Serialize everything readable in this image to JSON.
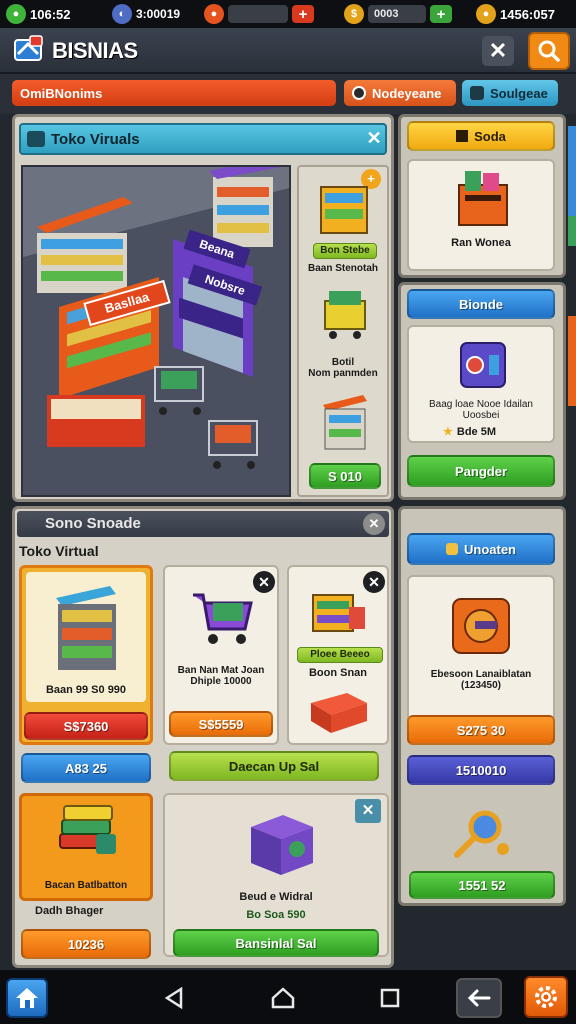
{
  "status": {
    "left_value": "106:52",
    "mid_value": "3:00019",
    "gold_value": "0003",
    "right_value": "1456:057"
  },
  "header": {
    "title": "BISNIAS"
  },
  "tabs": [
    {
      "label": "OmiBNonims"
    },
    {
      "label": "Nodeyeane"
    },
    {
      "label": "Soulgeae"
    }
  ],
  "store_panel": {
    "title": "Toko Viruals",
    "scene_signs": [
      "Basllaa",
      "Beana",
      "Nobsre"
    ],
    "items": [
      {
        "tag": "Bon Stebe",
        "name": "Baan Stenotah"
      },
      {
        "name": "Botil\nNom panmden"
      }
    ],
    "price_button": "S 010"
  },
  "right_top": {
    "header_button": "Soda",
    "card_label": "Ran Wonea"
  },
  "right_mid": {
    "header_button": "Bionde",
    "card_label": "Baag loae Nooe Idailan\nUoosbei",
    "card_price": "Bde 5M",
    "action_button": "Pangder"
  },
  "store2_panel": {
    "title": "Sono Snoade",
    "subtitle": "Toko Virtual",
    "card1": {
      "price_line": "Baan 99 S0 990",
      "button": "S$7360",
      "sub_button": "A83 25"
    },
    "card2": {
      "label": "Ban Nan Mat Joan\nDhiple 10000",
      "button": "S$5559"
    },
    "card3": {
      "tag": "Ploee Beeeo",
      "label": "Boon Snan"
    },
    "wide_button": "Daecan Up Sal",
    "card4": {
      "label": "Bacan Batlbatton",
      "sub_label": "Dadh Bhager",
      "button": "10236"
    },
    "card5": {
      "label": "Beud e Widral",
      "price": "Bo Soa 590",
      "button": "Bansinlal Sal"
    }
  },
  "right_bottom": {
    "header_button": "Unoaten",
    "card_label": "Ebesoon Lanaiblatan\n(123450)",
    "price_button": "S275 30",
    "navy_button": "1510010",
    "green_button": "1551 52"
  },
  "colors": {
    "accent_orange": "#f08a14",
    "header_bg": "#3b4350",
    "panel_bg": "#d6d1c6",
    "store_title_bg": "#3db1cf"
  },
  "icons": [
    "home-icon",
    "back-triangle-icon",
    "home-circle-icon",
    "recents-square-icon",
    "return-arrow-icon",
    "settings-gear-icon"
  ]
}
